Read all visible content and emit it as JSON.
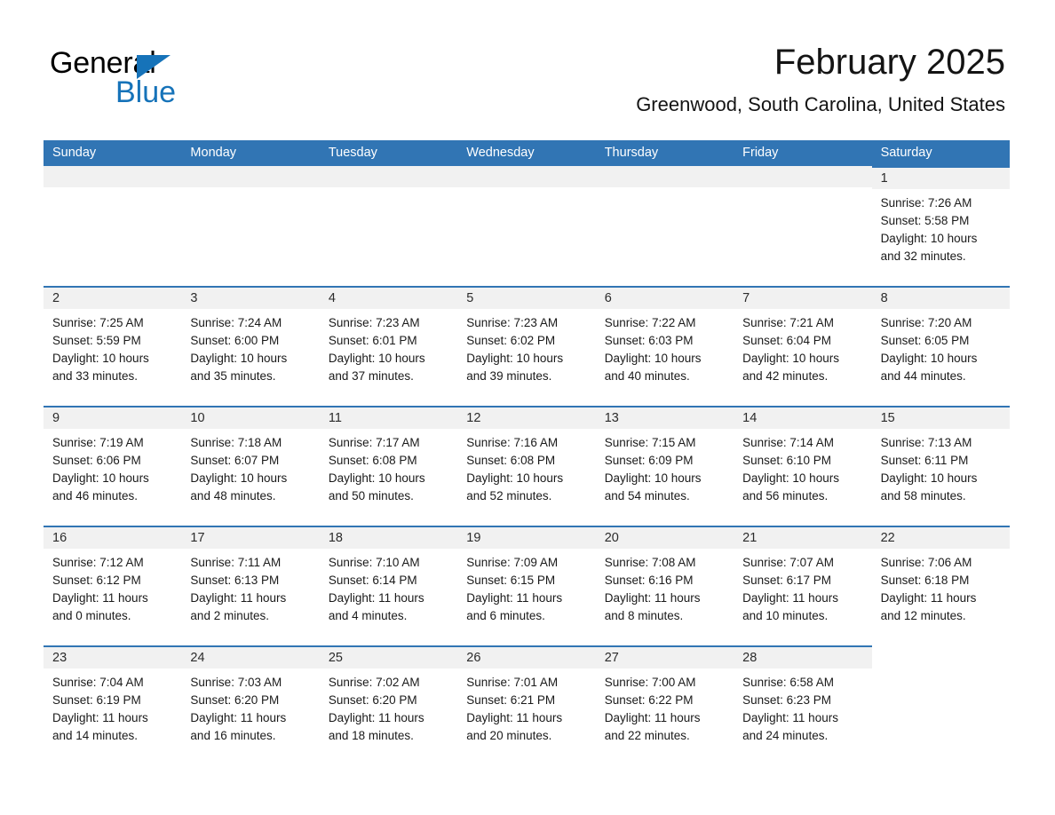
{
  "brand": {
    "word_one": "General",
    "word_two": "Blue",
    "triangle_color": "#1673b9",
    "text_color": "#000000"
  },
  "header": {
    "title": "February 2025",
    "subtitle": "Greenwood, South Carolina, United States"
  },
  "theme": {
    "header_blue": "#3175b4",
    "row_rule_blue": "#3175b4",
    "daynum_band": "#f1f1f1",
    "text": "#1a1a1a"
  },
  "weekdays": [
    "Sunday",
    "Monday",
    "Tuesday",
    "Wednesday",
    "Thursday",
    "Friday",
    "Saturday"
  ],
  "labels": {
    "sunrise_prefix": "Sunrise: ",
    "sunset_prefix": "Sunset: ",
    "daylight_prefix": "Daylight: "
  },
  "weeks": [
    [
      {
        "day": "",
        "sunrise": "",
        "sunset": "",
        "daylight_line1": "",
        "daylight_line2": "",
        "blank": true
      },
      {
        "day": "",
        "sunrise": "",
        "sunset": "",
        "daylight_line1": "",
        "daylight_line2": "",
        "blank": true
      },
      {
        "day": "",
        "sunrise": "",
        "sunset": "",
        "daylight_line1": "",
        "daylight_line2": "",
        "blank": true
      },
      {
        "day": "",
        "sunrise": "",
        "sunset": "",
        "daylight_line1": "",
        "daylight_line2": "",
        "blank": true
      },
      {
        "day": "",
        "sunrise": "",
        "sunset": "",
        "daylight_line1": "",
        "daylight_line2": "",
        "blank": true
      },
      {
        "day": "",
        "sunrise": "",
        "sunset": "",
        "daylight_line1": "",
        "daylight_line2": "",
        "blank": true
      },
      {
        "day": "1",
        "sunrise": "Sunrise: 7:26 AM",
        "sunset": "Sunset: 5:58 PM",
        "daylight_line1": "Daylight: 10 hours",
        "daylight_line2": "and 32 minutes.",
        "blank": false
      }
    ],
    [
      {
        "day": "2",
        "sunrise": "Sunrise: 7:25 AM",
        "sunset": "Sunset: 5:59 PM",
        "daylight_line1": "Daylight: 10 hours",
        "daylight_line2": "and 33 minutes.",
        "blank": false
      },
      {
        "day": "3",
        "sunrise": "Sunrise: 7:24 AM",
        "sunset": "Sunset: 6:00 PM",
        "daylight_line1": "Daylight: 10 hours",
        "daylight_line2": "and 35 minutes.",
        "blank": false
      },
      {
        "day": "4",
        "sunrise": "Sunrise: 7:23 AM",
        "sunset": "Sunset: 6:01 PM",
        "daylight_line1": "Daylight: 10 hours",
        "daylight_line2": "and 37 minutes.",
        "blank": false
      },
      {
        "day": "5",
        "sunrise": "Sunrise: 7:23 AM",
        "sunset": "Sunset: 6:02 PM",
        "daylight_line1": "Daylight: 10 hours",
        "daylight_line2": "and 39 minutes.",
        "blank": false
      },
      {
        "day": "6",
        "sunrise": "Sunrise: 7:22 AM",
        "sunset": "Sunset: 6:03 PM",
        "daylight_line1": "Daylight: 10 hours",
        "daylight_line2": "and 40 minutes.",
        "blank": false
      },
      {
        "day": "7",
        "sunrise": "Sunrise: 7:21 AM",
        "sunset": "Sunset: 6:04 PM",
        "daylight_line1": "Daylight: 10 hours",
        "daylight_line2": "and 42 minutes.",
        "blank": false
      },
      {
        "day": "8",
        "sunrise": "Sunrise: 7:20 AM",
        "sunset": "Sunset: 6:05 PM",
        "daylight_line1": "Daylight: 10 hours",
        "daylight_line2": "and 44 minutes.",
        "blank": false
      }
    ],
    [
      {
        "day": "9",
        "sunrise": "Sunrise: 7:19 AM",
        "sunset": "Sunset: 6:06 PM",
        "daylight_line1": "Daylight: 10 hours",
        "daylight_line2": "and 46 minutes.",
        "blank": false
      },
      {
        "day": "10",
        "sunrise": "Sunrise: 7:18 AM",
        "sunset": "Sunset: 6:07 PM",
        "daylight_line1": "Daylight: 10 hours",
        "daylight_line2": "and 48 minutes.",
        "blank": false
      },
      {
        "day": "11",
        "sunrise": "Sunrise: 7:17 AM",
        "sunset": "Sunset: 6:08 PM",
        "daylight_line1": "Daylight: 10 hours",
        "daylight_line2": "and 50 minutes.",
        "blank": false
      },
      {
        "day": "12",
        "sunrise": "Sunrise: 7:16 AM",
        "sunset": "Sunset: 6:08 PM",
        "daylight_line1": "Daylight: 10 hours",
        "daylight_line2": "and 52 minutes.",
        "blank": false
      },
      {
        "day": "13",
        "sunrise": "Sunrise: 7:15 AM",
        "sunset": "Sunset: 6:09 PM",
        "daylight_line1": "Daylight: 10 hours",
        "daylight_line2": "and 54 minutes.",
        "blank": false
      },
      {
        "day": "14",
        "sunrise": "Sunrise: 7:14 AM",
        "sunset": "Sunset: 6:10 PM",
        "daylight_line1": "Daylight: 10 hours",
        "daylight_line2": "and 56 minutes.",
        "blank": false
      },
      {
        "day": "15",
        "sunrise": "Sunrise: 7:13 AM",
        "sunset": "Sunset: 6:11 PM",
        "daylight_line1": "Daylight: 10 hours",
        "daylight_line2": "and 58 minutes.",
        "blank": false
      }
    ],
    [
      {
        "day": "16",
        "sunrise": "Sunrise: 7:12 AM",
        "sunset": "Sunset: 6:12 PM",
        "daylight_line1": "Daylight: 11 hours",
        "daylight_line2": "and 0 minutes.",
        "blank": false
      },
      {
        "day": "17",
        "sunrise": "Sunrise: 7:11 AM",
        "sunset": "Sunset: 6:13 PM",
        "daylight_line1": "Daylight: 11 hours",
        "daylight_line2": "and 2 minutes.",
        "blank": false
      },
      {
        "day": "18",
        "sunrise": "Sunrise: 7:10 AM",
        "sunset": "Sunset: 6:14 PM",
        "daylight_line1": "Daylight: 11 hours",
        "daylight_line2": "and 4 minutes.",
        "blank": false
      },
      {
        "day": "19",
        "sunrise": "Sunrise: 7:09 AM",
        "sunset": "Sunset: 6:15 PM",
        "daylight_line1": "Daylight: 11 hours",
        "daylight_line2": "and 6 minutes.",
        "blank": false
      },
      {
        "day": "20",
        "sunrise": "Sunrise: 7:08 AM",
        "sunset": "Sunset: 6:16 PM",
        "daylight_line1": "Daylight: 11 hours",
        "daylight_line2": "and 8 minutes.",
        "blank": false
      },
      {
        "day": "21",
        "sunrise": "Sunrise: 7:07 AM",
        "sunset": "Sunset: 6:17 PM",
        "daylight_line1": "Daylight: 11 hours",
        "daylight_line2": "and 10 minutes.",
        "blank": false
      },
      {
        "day": "22",
        "sunrise": "Sunrise: 7:06 AM",
        "sunset": "Sunset: 6:18 PM",
        "daylight_line1": "Daylight: 11 hours",
        "daylight_line2": "and 12 minutes.",
        "blank": false
      }
    ],
    [
      {
        "day": "23",
        "sunrise": "Sunrise: 7:04 AM",
        "sunset": "Sunset: 6:19 PM",
        "daylight_line1": "Daylight: 11 hours",
        "daylight_line2": "and 14 minutes.",
        "blank": false
      },
      {
        "day": "24",
        "sunrise": "Sunrise: 7:03 AM",
        "sunset": "Sunset: 6:20 PM",
        "daylight_line1": "Daylight: 11 hours",
        "daylight_line2": "and 16 minutes.",
        "blank": false
      },
      {
        "day": "25",
        "sunrise": "Sunrise: 7:02 AM",
        "sunset": "Sunset: 6:20 PM",
        "daylight_line1": "Daylight: 11 hours",
        "daylight_line2": "and 18 minutes.",
        "blank": false
      },
      {
        "day": "26",
        "sunrise": "Sunrise: 7:01 AM",
        "sunset": "Sunset: 6:21 PM",
        "daylight_line1": "Daylight: 11 hours",
        "daylight_line2": "and 20 minutes.",
        "blank": false
      },
      {
        "day": "27",
        "sunrise": "Sunrise: 7:00 AM",
        "sunset": "Sunset: 6:22 PM",
        "daylight_line1": "Daylight: 11 hours",
        "daylight_line2": "and 22 minutes.",
        "blank": false
      },
      {
        "day": "28",
        "sunrise": "Sunrise: 6:58 AM",
        "sunset": "Sunset: 6:23 PM",
        "daylight_line1": "Daylight: 11 hours",
        "daylight_line2": "and 24 minutes.",
        "blank": false
      },
      {
        "day": "",
        "sunrise": "",
        "sunset": "",
        "daylight_line1": "",
        "daylight_line2": "",
        "blank": true
      }
    ]
  ]
}
